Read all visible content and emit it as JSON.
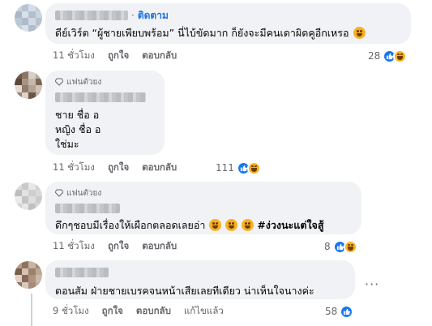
{
  "comments": [
    {
      "text_lines": [
        "ดีย์เวิร์ต “ผู้ชายเพียบพร้อม” นี่ไบ้ขัดมาก ก็ยังจะมีคนเดาผิดคูอีกเหรอ"
      ],
      "follow_label": "ติดตาม",
      "dot": "·",
      "actions": {
        "time": "11 ชั่วโมง",
        "like": "ถูกใจ",
        "reply": "ตอบกลับ"
      },
      "reaction_count": "28"
    },
    {
      "badge": "แฟนตัวยง",
      "text_lines": [
        "ชาย ชื่อ อ",
        "หญิง ชื่อ อ",
        "ใช่มะ"
      ],
      "actions": {
        "time": "11 ชั่วโมง",
        "like": "ถูกใจ",
        "reply": "ตอบกลับ"
      },
      "reaction_count": "111"
    },
    {
      "badge": "แฟนตัวยง",
      "text_main": "ดึกๆชอบมีเรื่องให้เผือกตลอดเลยอ่า",
      "hashtag": "#ง่วงนะแต่ใจสู้",
      "actions": {
        "time": "11 ชั่วโมง",
        "like": "ถูกใจ",
        "reply": "ตอบกลับ"
      },
      "reaction_count": "8"
    },
    {
      "text_lines": [
        "ตอนสัม ฝ่ายชายเบรคจนหน้าเสียเลยทีเดียว น่าเห็นใจนางค่ะ"
      ],
      "actions": {
        "time": "9 ชั่วโมง",
        "like": "ถูกใจ",
        "reply": "ตอบกลับ",
        "edited": "แก้ไขแล้ว"
      },
      "reaction_count": "58"
    }
  ],
  "more_options": "···",
  "colors": {
    "bubble": "#f0f2f5",
    "link": "#1b74e4",
    "meta": "#65676b",
    "like": "#1877f2",
    "haha": "#f7b125"
  },
  "icons": [
    "diamond-icon",
    "like-reaction-icon",
    "haha-reaction-icon",
    "laughing-emoji-icon",
    "more-options-icon"
  ]
}
